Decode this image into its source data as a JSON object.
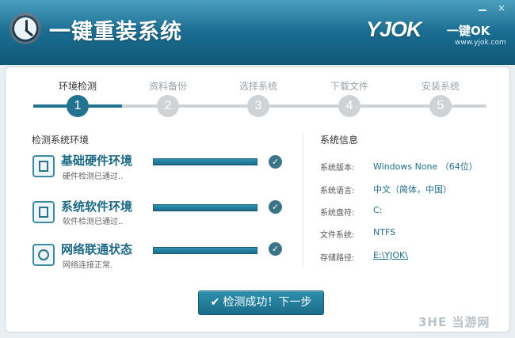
{
  "app": {
    "title": "一键重装系统",
    "logo_text": "YJOK",
    "logo_tag": "一键OK",
    "logo_url": "www.yjok.com"
  },
  "window_controls": {
    "minimize_icon": "minimize-icon",
    "close_label": "×"
  },
  "steps": [
    {
      "label": "环境检测",
      "number": "1",
      "active": true
    },
    {
      "label": "资料备份",
      "number": "2",
      "active": false
    },
    {
      "label": "选择系统",
      "number": "3",
      "active": false
    },
    {
      "label": "下载文件",
      "number": "4",
      "active": false
    },
    {
      "label": "安装系统",
      "number": "5",
      "active": false
    }
  ],
  "detect": {
    "section_title": "检测系统环境",
    "items": [
      {
        "title": "基础硬件环境",
        "desc": "硬件检测已通过..",
        "progress": 1.0,
        "icon": "hardware-icon"
      },
      {
        "title": "系统软件环境",
        "desc": "软件检测已通过..",
        "progress": 1.0,
        "icon": "monitor-icon"
      },
      {
        "title": "网络联通状态",
        "desc": "网络连接正常.",
        "progress": 1.0,
        "icon": "globe-icon"
      }
    ]
  },
  "sysinfo": {
    "section_title": "系统信息",
    "rows": [
      {
        "key": "系统版本:",
        "value": "Windows None （64位）"
      },
      {
        "key": "系统语言:",
        "value": "中文（简体，中国）"
      },
      {
        "key": "系统盘符:",
        "value": "C:"
      },
      {
        "key": "文件系统:",
        "value": "NTFS"
      },
      {
        "key": "存储路径:",
        "value": "E:\\YJOK\\"
      }
    ]
  },
  "next_button": {
    "label": "检测成功！下一步"
  },
  "watermark": "3HE 当游网",
  "colors": {
    "accent": "#21738f",
    "header": "#1b6f93",
    "inactive": "#cfd3d6"
  }
}
